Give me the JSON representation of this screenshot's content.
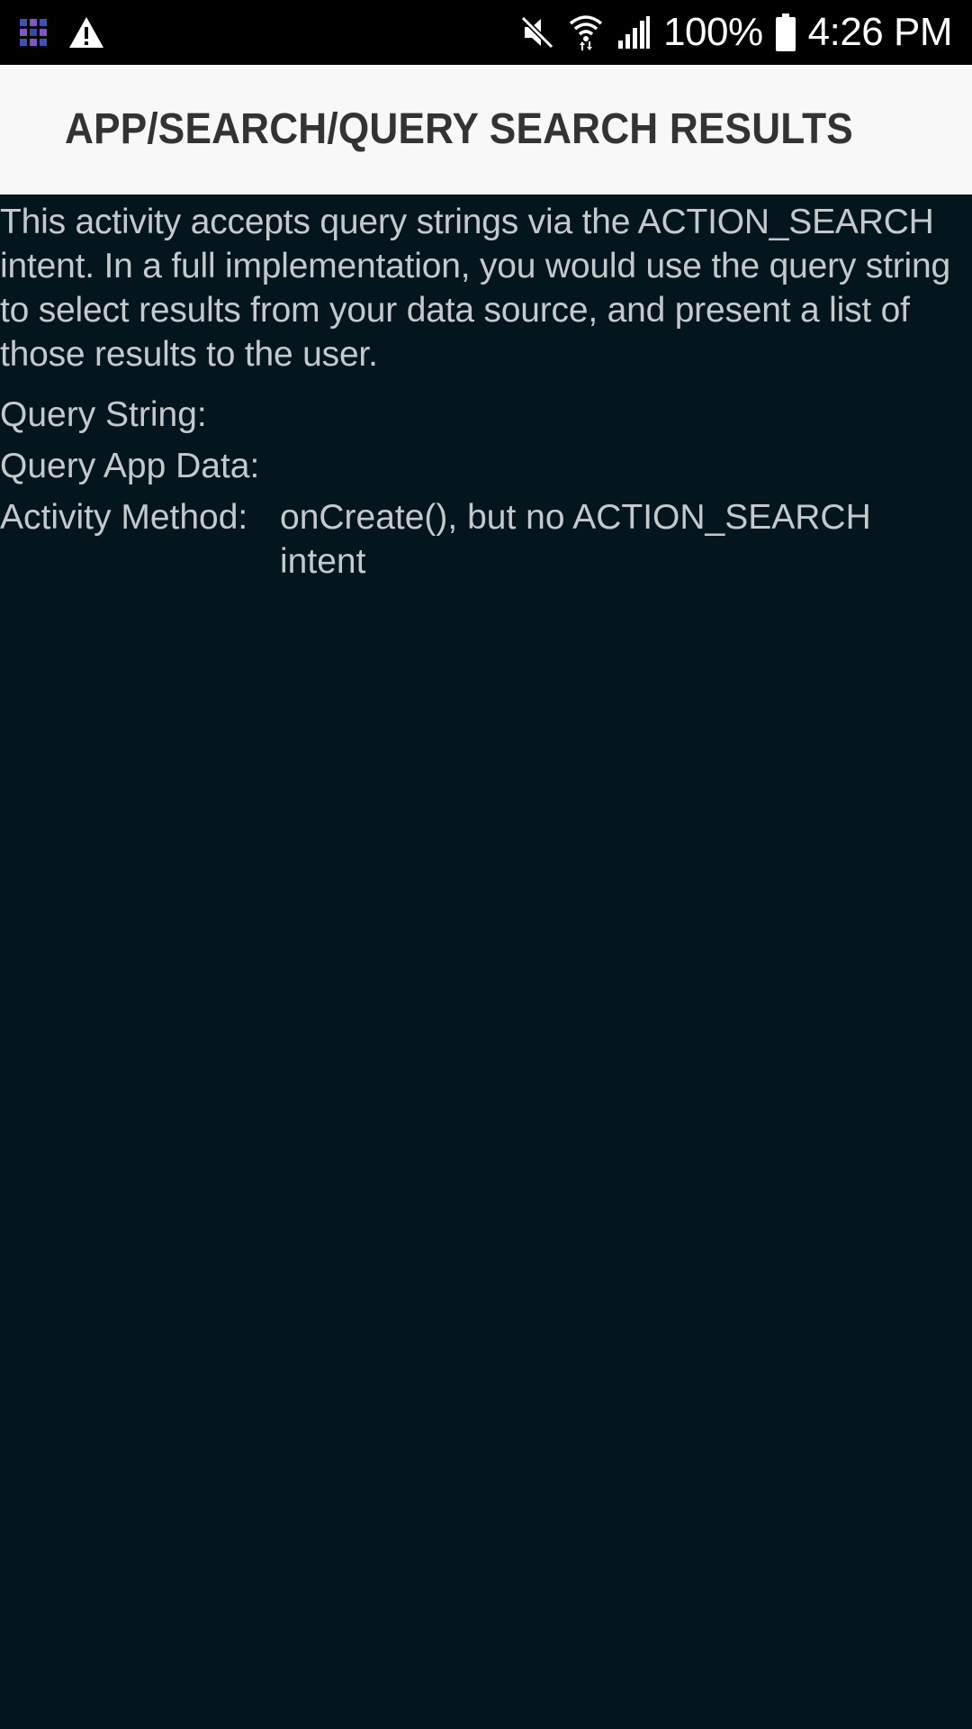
{
  "status_bar": {
    "battery_percent": "100%",
    "time": "4:26 PM",
    "icons": [
      "app-grid-icon",
      "warning-icon",
      "mute-icon",
      "wifi-icon",
      "signal-icon",
      "battery-icon"
    ]
  },
  "app_bar": {
    "title": "APP/SEARCH/QUERY SEARCH RESULTS"
  },
  "content": {
    "intro": "This activity accepts query strings via the ACTION_SEARCH intent. In a full implementation, you would use the query string to select results from your data source, and present a list of those results to the user.",
    "fields": [
      {
        "label": "Query String:",
        "value": ""
      },
      {
        "label": "Query App Data:",
        "value": ""
      },
      {
        "label": "Activity Method:",
        "value": "onCreate(), but no ACTION_SEARCH intent"
      }
    ]
  },
  "colors": {
    "background": "#03161e",
    "status_bar": "#000000",
    "app_bar": "#f8f8f8",
    "title_text": "#333333",
    "body_text": "#c4c9cc"
  }
}
